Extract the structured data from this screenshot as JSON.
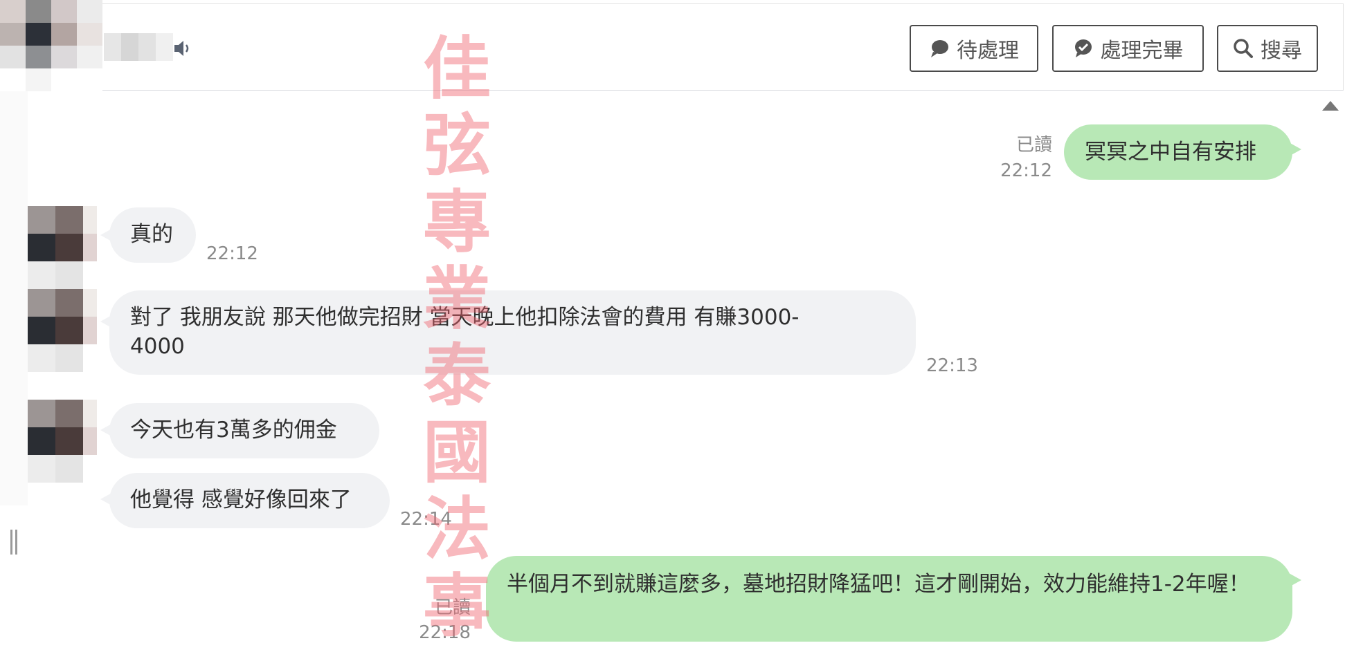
{
  "header": {
    "buttons": {
      "pending": "待處理",
      "done": "處理完畢",
      "search": "搜尋"
    }
  },
  "watermark": [
    "佳",
    "弦",
    "專",
    "業",
    "泰",
    "國",
    "法",
    "事"
  ],
  "messages": [
    {
      "side": "out",
      "text": "冥冥之中自有安排",
      "read": "已讀",
      "time": "22:12"
    },
    {
      "side": "in",
      "text": "真的",
      "time": "22:12"
    },
    {
      "side": "in",
      "text": "對了 我朋友說 那天他做完招財 當天晚上他扣除法會的費用 有賺3000-4000",
      "time": "22:13"
    },
    {
      "side": "in",
      "text": "今天也有3萬多的佣金",
      "time": ""
    },
    {
      "side": "in",
      "text": "他覺得 感覺好像回來了",
      "time": "22:14"
    },
    {
      "side": "out",
      "text": "半個月不到就賺這麼多，墓地招財降猛吧！這才剛開始，效力能維持1-2年喔！",
      "read": "已讀",
      "time": "22:18"
    }
  ],
  "colors": {
    "outgoing_bubble": "#b8e8b6",
    "incoming_bubble": "#f1f2f4",
    "watermark": "#f0646e"
  },
  "icons": {
    "speaker": "speaker-icon",
    "pending": "chat-bubble-icon",
    "done": "check-bubble-icon",
    "search": "search-icon"
  }
}
